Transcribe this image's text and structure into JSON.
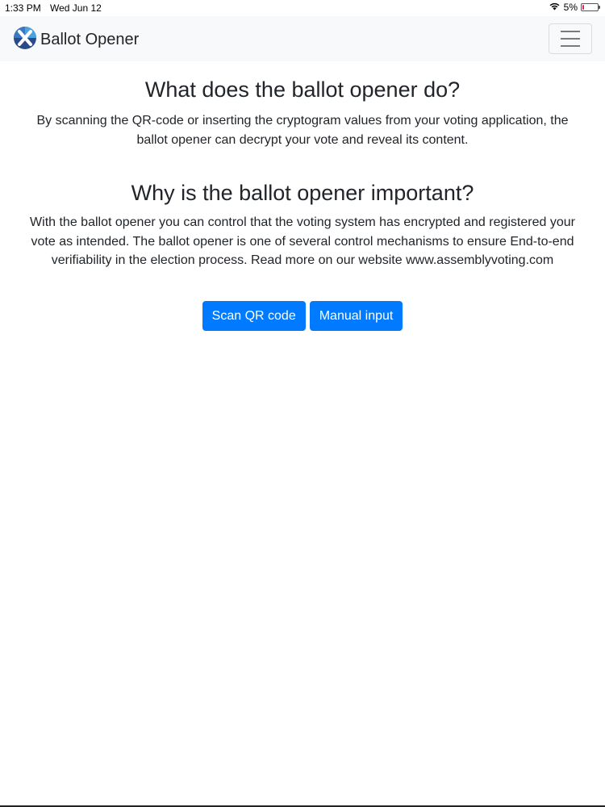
{
  "status_bar": {
    "time": "1:33 PM",
    "date": "Wed Jun 12",
    "battery_text": "5%",
    "battery_level": 0.05,
    "icons": [
      "wifi-icon",
      "battery-icon"
    ]
  },
  "navbar": {
    "brand_name": "Ballot Opener",
    "logo_icon": "x-logo-icon",
    "menu_icon": "hamburger-menu-icon"
  },
  "sections": {
    "what": {
      "heading": "What does the ballot opener do?",
      "body": "By scanning the QR-code or inserting the cryptogram values from your voting application, the ballot opener can decrypt your vote and reveal its content."
    },
    "why": {
      "heading": "Why is the ballot opener important?",
      "body": "With the ballot opener you can control that the voting system has encrypted and registered your vote as intended. The ballot opener is one of several control mechanisms to ensure End-to-end verifiability in the election process. Read more on our website www.assemblyvoting.com"
    }
  },
  "actions": {
    "scan_label": "Scan QR code",
    "manual_label": "Manual input"
  },
  "colors": {
    "primary": "#007bff",
    "navbar_bg": "#f8f9fa",
    "text": "#212529",
    "logo_dark": "#2b4a8b",
    "logo_light": "#4aa3df"
  }
}
